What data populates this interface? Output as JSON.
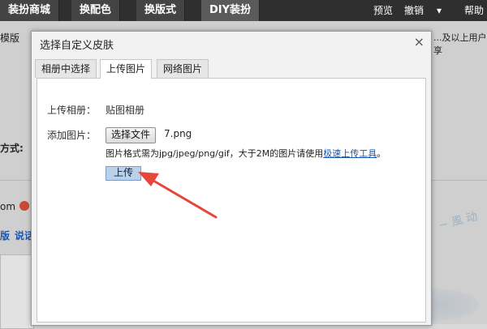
{
  "topbar": {
    "tabs": [
      "装扮商城",
      "换配色",
      "换版式",
      "DIY装扮"
    ],
    "right": {
      "preview": "预览",
      "undo": "撤销",
      "dropdown": "▾",
      "help": "帮助"
    }
  },
  "background": {
    "template_label": "模版",
    "notice": "...及以上用户享",
    "method_label": "方式:",
    "om_text": "om",
    "bottom_a": "版",
    "bottom_b": "说话",
    "brush_text": "~ 風 动"
  },
  "dialog": {
    "title": "选择自定义皮肤",
    "close": "×",
    "tabs": [
      {
        "label": "相册中选择"
      },
      {
        "label": "上传图片"
      },
      {
        "label": "网络图片"
      }
    ],
    "active_tab": 1,
    "upload": {
      "album_label": "上传相册：",
      "album_value": "贴图相册",
      "add_label": "添加图片：",
      "file_button": "选择文件",
      "file_name": "7.png",
      "hint_prefix": "图片格式需为jpg/jpeg/png/gif，大于2M的图片请使用",
      "hint_link": "极速上传工具",
      "hint_suffix": "。",
      "upload_button": "上传"
    }
  },
  "colors": {
    "accent": "#e8463a",
    "link": "#1a56b0",
    "upload_button": "#b9d1ea"
  },
  "icons": {
    "close": "close-icon",
    "dropdown": "chevron-down-icon",
    "arrow": "red-arrow-annotation"
  }
}
